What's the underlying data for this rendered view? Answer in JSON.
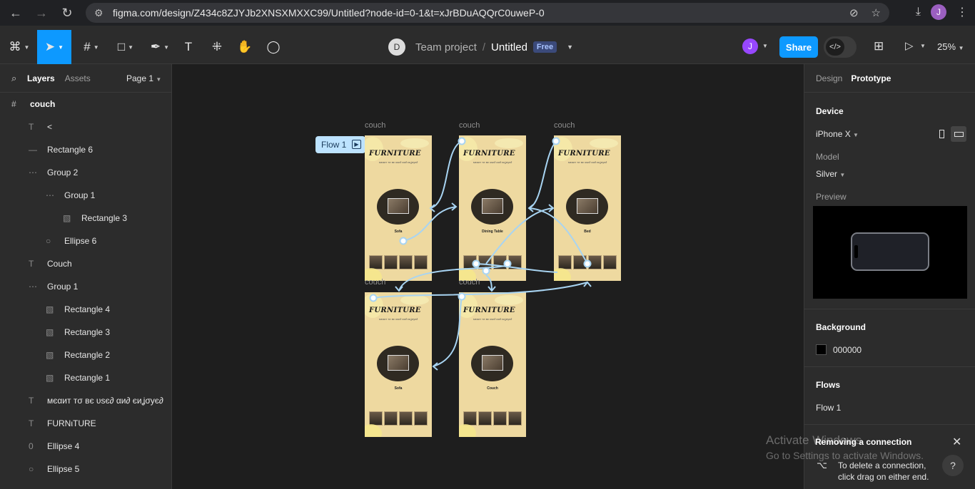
{
  "browser": {
    "url": "figma.com/design/Z434c8ZJYJb2XNSXMXXC99/Untitled?node-id=0-1&t=xJrBDuAQQrC0uweP-0",
    "profile_initial": "J"
  },
  "toolbar": {
    "team_initial": "D",
    "team": "Team project",
    "separator": "/",
    "file": "Untitled",
    "plan_badge": "Free",
    "user_initial": "J",
    "share": "Share",
    "zoom": "25%"
  },
  "left_panel": {
    "tabs": [
      "Layers",
      "Assets"
    ],
    "page": "Page 1",
    "layers": [
      {
        "icon": "#",
        "name": "couch"
      },
      {
        "icon": "T",
        "name": "<"
      },
      {
        "icon": "—",
        "name": "Rectangle 6"
      },
      {
        "icon": "⋯",
        "name": "Group 2"
      },
      {
        "icon": "⋯",
        "name": "Group 1"
      },
      {
        "icon": "▧",
        "name": "Rectangle 3"
      },
      {
        "icon": "○",
        "name": "Ellipse 6"
      },
      {
        "icon": "T",
        "name": "Couch"
      },
      {
        "icon": "⋯",
        "name": "Group 1"
      },
      {
        "icon": "▧",
        "name": "Rectangle 4"
      },
      {
        "icon": "▧",
        "name": "Rectangle 3"
      },
      {
        "icon": "▧",
        "name": "Rectangle 2"
      },
      {
        "icon": "▧",
        "name": "Rectangle 1"
      },
      {
        "icon": "T",
        "name": "ᴍєαит тσ вє υѕє∂ αи∂ єиʝσує∂"
      },
      {
        "icon": "T",
        "name": "FURNιTURE"
      },
      {
        "icon": "0",
        "name": "Ellipse 4"
      },
      {
        "icon": "○",
        "name": "Ellipse 5"
      }
    ]
  },
  "canvas": {
    "flow_chip": "Flow 1",
    "frames": [
      {
        "label": "couch",
        "title": "FURNITURE",
        "subtitle": "ᴍєαит тσ вє υѕє∂ αи∂ єиʝσує∂",
        "caption": "Sofa"
      },
      {
        "label": "couch",
        "title": "FURNITURE",
        "subtitle": "ᴍєαит тσ вє υѕє∂ αи∂ єиʝσує∂",
        "caption": "Dining Table"
      },
      {
        "label": "couch",
        "title": "FURNITURE",
        "subtitle": "ᴍєαит тσ вє υѕє∂ αи∂ єиʝσує∂",
        "caption": "Bed"
      },
      {
        "label": "couch",
        "title": "FURNITURE",
        "subtitle": "ᴍєαит тσ вє υѕє∂ αи∂ єиʝσує∂",
        "caption": "Sofa"
      },
      {
        "label": "couch",
        "title": "FURNITURE",
        "subtitle": "ᴍєαит тσ вє υѕє∂ αи∂ єиʝσує∂",
        "caption": "Couch"
      }
    ]
  },
  "right_panel": {
    "tabs": [
      "Design",
      "Prototype"
    ],
    "device_heading": "Device",
    "device": "iPhone X",
    "model_label": "Model",
    "model": "Silver",
    "preview_label": "Preview",
    "background_heading": "Background",
    "background_hex": "000000",
    "flows_heading": "Flows",
    "flow_name": "Flow 1"
  },
  "watermark": {
    "line1": "Activate Windows",
    "line2": "Go to Settings to activate Windows."
  },
  "toast": {
    "title": "Removing a connection",
    "body": "To delete a connection, click drag on either end."
  },
  "colors": {
    "accent": "#0d99ff",
    "canvas": "#1e1e1e",
    "frame_fill": "#eed9a0",
    "connector": "#a8d4f2"
  }
}
